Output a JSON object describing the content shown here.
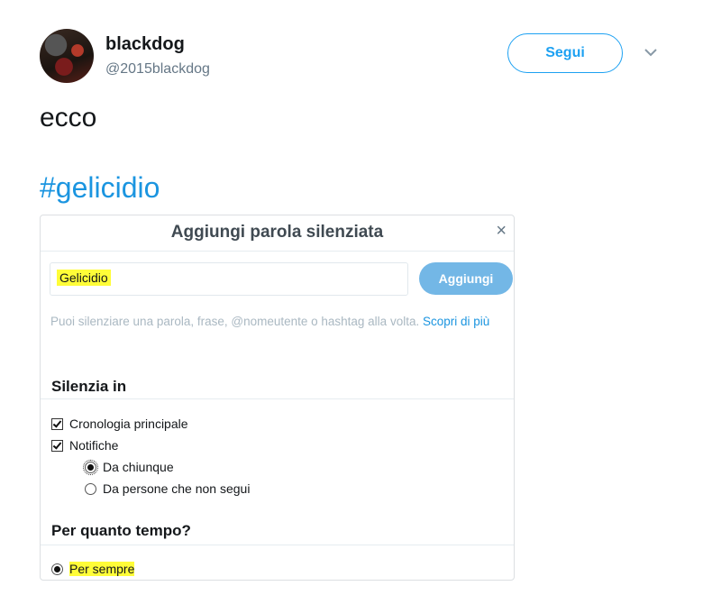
{
  "tweet": {
    "user_name": "blackdog",
    "handle": "@2015blackdog",
    "follow_label": "Segui",
    "text": "ecco",
    "hashtag": "#gelicidio"
  },
  "dialog": {
    "title": "Aggiungi parola silenziata",
    "close_glyph": "×",
    "input_value": "Gelicidio",
    "add_label": "Aggiungi",
    "help_text": "Puoi silenziare una parola, frase, @nomeutente o hashtag alla volta.",
    "help_link": "Scopri di più",
    "mute_in_title": "Silenzia in",
    "options": {
      "home_timeline": "Cronologia principale",
      "notifications": "Notifiche",
      "from_anyone": "Da chiunque",
      "from_not_following": "Da persone che non segui"
    },
    "duration_title": "Per quanto tempo?",
    "forever": "Per sempre"
  },
  "colors": {
    "accent": "#1da1f2",
    "highlight": "#fffd38",
    "add_button": "#73b7e6"
  }
}
